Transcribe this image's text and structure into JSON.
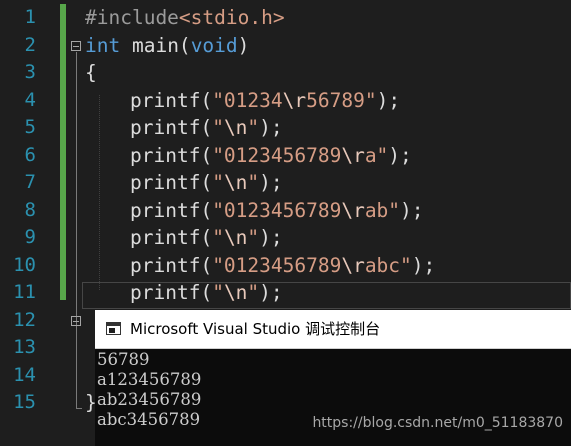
{
  "editor": {
    "line_numbers": [
      "1",
      "2",
      "3",
      "4",
      "5",
      "6",
      "7",
      "8",
      "9",
      "10",
      "11",
      "12",
      "13",
      "14",
      "15"
    ],
    "line1": {
      "directive": "#include",
      "header": "<stdio.h>"
    },
    "line2": {
      "type": "int",
      "name": " main(",
      "param": "void",
      "close": ")"
    },
    "line3": "{",
    "line4": {
      "fn": "printf(",
      "s1": "\"01234",
      "esc": "\\r",
      "s2": "56789\"",
      "end": ");"
    },
    "line5": {
      "fn": "printf(",
      "s1": "\"",
      "esc": "\\n",
      "s2": "\"",
      "end": ");"
    },
    "line6": {
      "fn": "printf(",
      "s1": "\"0123456789",
      "esc": "\\r",
      "s2": "a\"",
      "end": ");"
    },
    "line7": {
      "fn": "printf(",
      "s1": "\"",
      "esc": "\\n",
      "s2": "\"",
      "end": ");"
    },
    "line8": {
      "fn": "printf(",
      "s1": "\"0123456789",
      "esc": "\\r",
      "s2": "ab\"",
      "end": ");"
    },
    "line9": {
      "fn": "printf(",
      "s1": "\"",
      "esc": "\\n",
      "s2": "\"",
      "end": ");"
    },
    "line10": {
      "fn": "printf(",
      "s1": "\"0123456789",
      "esc": "\\r",
      "s2": "abc\"",
      "end": ");"
    },
    "line11": {
      "fn": "printf(",
      "s1": "\"",
      "esc": "\\n",
      "s2": "\"",
      "end": ");"
    },
    "line15": "}"
  },
  "console": {
    "title": "Microsoft Visual Studio 调试控制台",
    "output": [
      "56789",
      "a123456789",
      "ab23456789",
      "abc3456789"
    ]
  },
  "watermark": "https://blog.csdn.net/m0_51183870",
  "colors": {
    "background": "#1e1e1e",
    "line_number": "#2b91af",
    "keyword": "#569cd6",
    "string": "#d69d85",
    "preprocessor": "#9b9b9b",
    "change_bar": "#57a64a",
    "console_bg": "#0c0c0c"
  }
}
